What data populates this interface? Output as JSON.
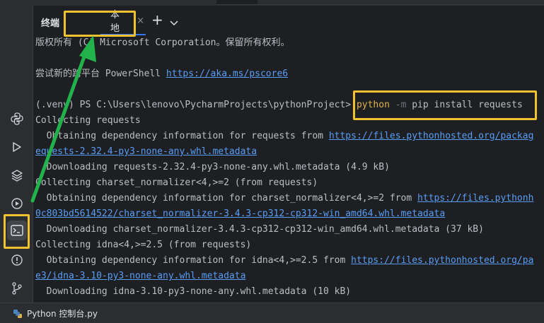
{
  "tabs": {
    "terminal_label": "终端",
    "local_tab": "本地",
    "close": "×",
    "add": "+",
    "more": "⌄"
  },
  "terminal": {
    "line1": "版权所有 (C) Microsoft Corporation。保留所有权利。",
    "line2_prefix": "尝试新的跨平台 PowerShell ",
    "line2_link": "https://aka.ms/pscore6",
    "prompt": "(.venv) PS C:\\Users\\lenovo\\PycharmProjects\\pythonProject> ",
    "cmd_python": "python",
    "cmd_flag": " -m ",
    "cmd_rest": "pip install requests",
    "out": [
      {
        "text": "Collecting requests",
        "link": ""
      },
      {
        "text": "  Obtaining dependency information for requests from ",
        "link": "https://files.pythonhosted.org/packag"
      },
      {
        "text": "",
        "link": "equests-2.32.4-py3-none-any.whl.metadata"
      },
      {
        "text": "  Downloading requests-2.32.4-py3-none-any.whl.metadata (4.9 kB)",
        "link": ""
      },
      {
        "text": "Collecting charset_normalizer<4,>=2 (from requests)",
        "link": ""
      },
      {
        "text": "  Obtaining dependency information for charset_normalizer<4,>=2 from ",
        "link": "https://files.pythonh"
      },
      {
        "text": "",
        "link": "0c803bd5614522/charset_normalizer-3.4.3-cp312-cp312-win_amd64.whl.metadata"
      },
      {
        "text": "  Downloading charset_normalizer-3.4.3-cp312-cp312-win_amd64.whl.metadata (37 kB)",
        "link": ""
      },
      {
        "text": "Collecting idna<4,>=2.5 (from requests)",
        "link": ""
      },
      {
        "text": "  Obtaining dependency information for idna<4,>=2.5 from ",
        "link": "https://files.pythonhosted.org/pa"
      },
      {
        "text": "",
        "link": "e3/idna-3.10-py3-none-any.whl.metadata"
      },
      {
        "text": "  Downloading idna-3.10-py3-none-any.whl.metadata (10 kB)",
        "link": ""
      }
    ]
  },
  "status": {
    "file": "Python 控制台.py"
  },
  "sidebar_icons": [
    "python-console-icon",
    "run-icon",
    "layers-icon",
    "services-icon",
    "terminal-icon",
    "problems-icon",
    "git-icon"
  ],
  "colors": {
    "highlight": "#f0c230",
    "arrow": "#22b24c",
    "link": "#589df6",
    "command": "#e0b04d"
  }
}
